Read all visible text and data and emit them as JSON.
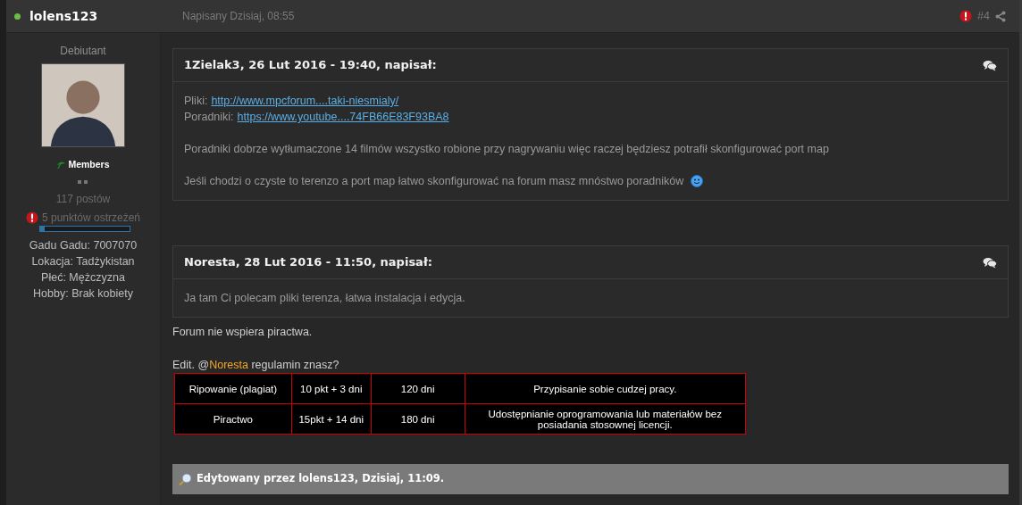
{
  "post": {
    "author": "lolens123",
    "online": true,
    "posted": "Napisany Dzisiaj, 08:55",
    "number": "#4",
    "reported": true
  },
  "sidebar": {
    "rank": "Debiutant",
    "group": "Members",
    "posts": "117 postów",
    "warning": {
      "text": "5 punktów ostrzeżeń",
      "level": 0.05
    },
    "fields": [
      {
        "label": "Gadu Gadu:",
        "value": "7007070"
      },
      {
        "label": "Lokacja:",
        "value": "Tadżykistan"
      },
      {
        "label": "Płeć:",
        "value": "Mężczyzna"
      },
      {
        "label": "Hobby:",
        "value": "Brak kobiety"
      }
    ]
  },
  "quotes": [
    {
      "citation": "1Zielak3, 26 Lut 2016 - 19:40, napisał:",
      "paragraphs": [
        [
          {
            "kind": "link",
            "label": "Pliki:",
            "link": "http://www.mpcforum....taki-niesmialy/"
          },
          {
            "kind": "link",
            "label": "Poradniki:",
            "link": "https://www.youtube....74FB66E83F93BA8"
          }
        ],
        [
          {
            "kind": "text",
            "text": "Poradniki dobrze wytłumaczone 14 filmów wszystko robione przy nagrywaniu więc raczej będziesz potrafił skonfigurować port map"
          }
        ],
        [
          {
            "kind": "text",
            "text": "Jeśli chodzi o czyste to terenzo a port map łatwo skonfigurować na forum masz mnóstwo poradników",
            "smiley": true
          }
        ]
      ]
    },
    {
      "citation": "Noresta, 28 Lut 2016 - 11:50, napisał:",
      "paragraphs": [
        [
          {
            "kind": "text",
            "text": "Ja tam Ci polecam pliki terenza, łatwa instalacja i edycja."
          }
        ]
      ]
    }
  ],
  "body": [
    {
      "kind": "text",
      "text": "Forum nie wspiera piractwa."
    },
    {
      "kind": "mention",
      "before": "Edit. @",
      "mention": "Noresta",
      "after": " regulamin znasz?"
    }
  ],
  "table": {
    "rows": [
      [
        "Ripowanie (plagiat)",
        "10 pkt + 3 dni",
        "120 dni",
        "Przypisanie sobie cudzej pracy."
      ],
      [
        "Piractwo",
        "15pkt + 14 dni",
        "180 dni",
        "Udostępnianie oprogramowania lub materiałów bez posiadania stosownej licencji."
      ]
    ]
  },
  "edited": "Edytowany przez lolens123, Dzisiaj, 11:09."
}
